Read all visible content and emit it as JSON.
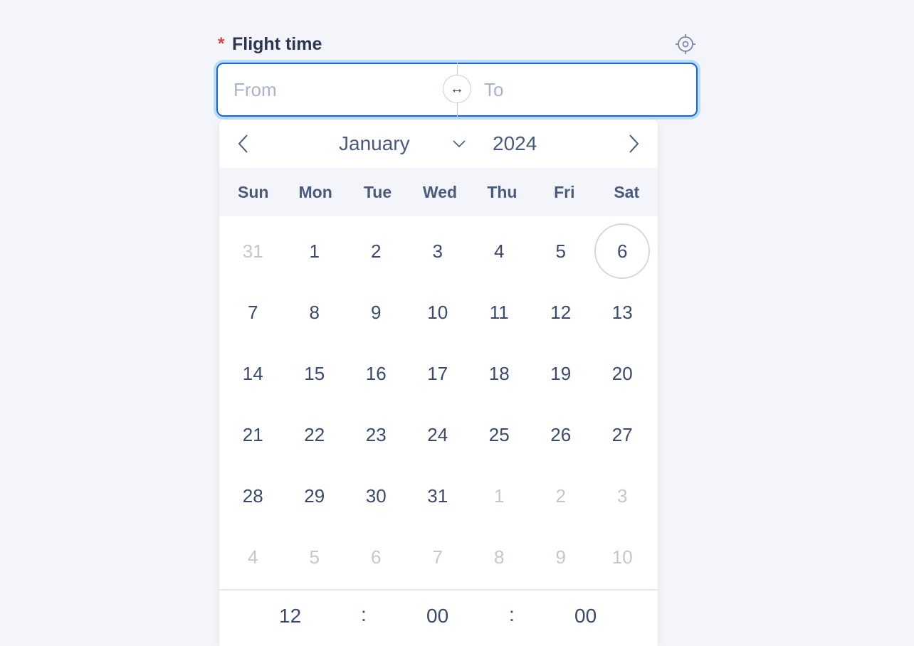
{
  "field": {
    "required_mark": "*",
    "label": "Flight time",
    "from_placeholder": "From",
    "to_placeholder": "To",
    "swap_glyph": "↔"
  },
  "calendar": {
    "month": "January",
    "year": "2024",
    "weekdays": [
      "Sun",
      "Mon",
      "Tue",
      "Wed",
      "Thu",
      "Fri",
      "Sat"
    ],
    "weeks": [
      [
        {
          "d": "31",
          "other": true
        },
        {
          "d": "1"
        },
        {
          "d": "2"
        },
        {
          "d": "3"
        },
        {
          "d": "4"
        },
        {
          "d": "5"
        },
        {
          "d": "6",
          "today": true
        }
      ],
      [
        {
          "d": "7"
        },
        {
          "d": "8"
        },
        {
          "d": "9"
        },
        {
          "d": "10"
        },
        {
          "d": "11"
        },
        {
          "d": "12"
        },
        {
          "d": "13"
        }
      ],
      [
        {
          "d": "14"
        },
        {
          "d": "15"
        },
        {
          "d": "16"
        },
        {
          "d": "17"
        },
        {
          "d": "18"
        },
        {
          "d": "19"
        },
        {
          "d": "20"
        }
      ],
      [
        {
          "d": "21"
        },
        {
          "d": "22"
        },
        {
          "d": "23"
        },
        {
          "d": "24"
        },
        {
          "d": "25"
        },
        {
          "d": "26"
        },
        {
          "d": "27"
        }
      ],
      [
        {
          "d": "28"
        },
        {
          "d": "29"
        },
        {
          "d": "30"
        },
        {
          "d": "31"
        },
        {
          "d": "1",
          "other": true
        },
        {
          "d": "2",
          "other": true
        },
        {
          "d": "3",
          "other": true
        }
      ],
      [
        {
          "d": "4",
          "other": true
        },
        {
          "d": "5",
          "other": true
        },
        {
          "d": "6",
          "other": true
        },
        {
          "d": "7",
          "other": true
        },
        {
          "d": "8",
          "other": true
        },
        {
          "d": "9",
          "other": true
        },
        {
          "d": "10",
          "other": true
        }
      ]
    ],
    "time": {
      "hours": "12",
      "minutes": "00",
      "seconds": "00",
      "separator": ":"
    }
  },
  "colors": {
    "accent": "#1565d8",
    "focus_ring": "#b9dcfb",
    "required": "#e53e3e"
  }
}
